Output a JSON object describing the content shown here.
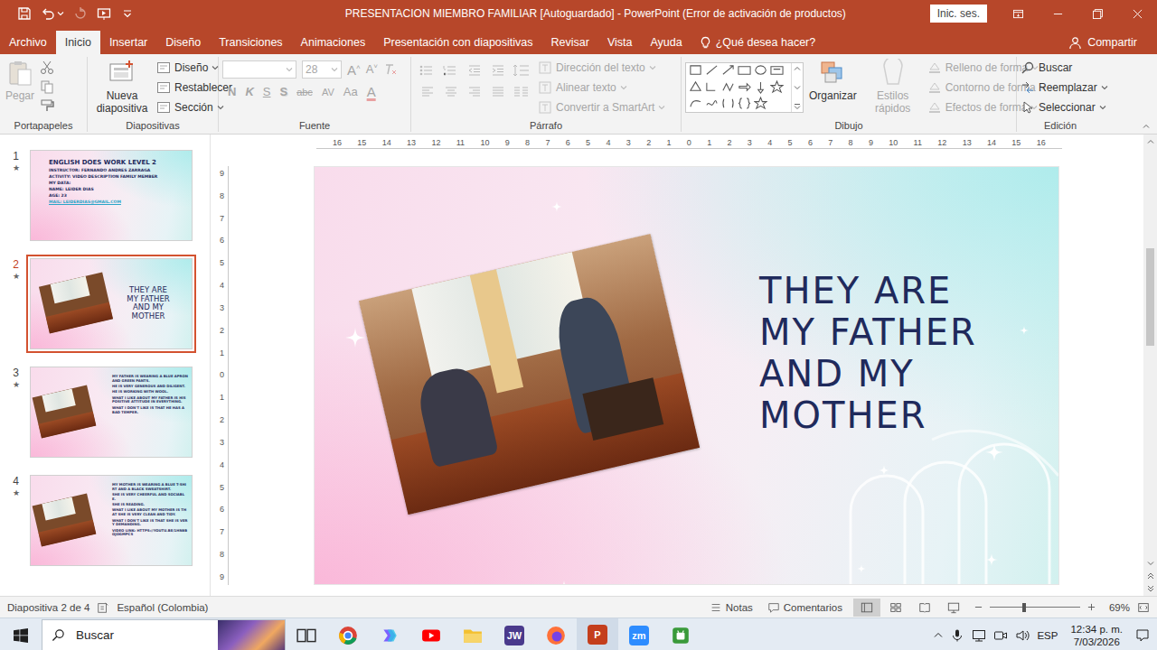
{
  "window": {
    "title": "PRESENTACION MIEMBRO FAMILIAR [Autoguardado] - PowerPoint (Error de activación de productos)",
    "signin": "Inic. ses."
  },
  "tabs": [
    {
      "label": "Archivo",
      "selected": false
    },
    {
      "label": "Inicio",
      "selected": true
    },
    {
      "label": "Insertar",
      "selected": false
    },
    {
      "label": "Diseño",
      "selected": false
    },
    {
      "label": "Transiciones",
      "selected": false
    },
    {
      "label": "Animaciones",
      "selected": false
    },
    {
      "label": "Presentación con diapositivas",
      "selected": false
    },
    {
      "label": "Revisar",
      "selected": false
    },
    {
      "label": "Vista",
      "selected": false
    },
    {
      "label": "Ayuda",
      "selected": false
    }
  ],
  "tell_me": "¿Qué desea hacer?",
  "share": "Compartir",
  "ribbon": {
    "clipboard": {
      "title": "Portapapeles",
      "paste": {
        "label": "Pegar",
        "disabled": true
      }
    },
    "slides": {
      "title": "Diapositivas",
      "new_slide": "Nueva diapositiva",
      "commands": [
        {
          "label": "Diseño",
          "dropdown": true
        },
        {
          "label": "Restablecer",
          "dropdown": false
        },
        {
          "label": "Sección",
          "dropdown": true
        }
      ]
    },
    "font": {
      "title": "Fuente",
      "name": "",
      "size": "28",
      "grow": "A",
      "shrink": "A",
      "styles": [
        "N",
        "K",
        "S",
        "S",
        "abc",
        "AV",
        "Aa",
        "A"
      ],
      "disabled": true
    },
    "paragraph": {
      "title": "Párrafo",
      "commands": [
        {
          "label": "Dirección del texto",
          "disabled": true
        },
        {
          "label": "Alinear texto",
          "disabled": true
        },
        {
          "label": "Convertir a SmartArt",
          "disabled": true
        }
      ]
    },
    "drawing": {
      "title": "Dibujo",
      "arrange": "Organizar",
      "quick_styles": {
        "label": "Estilos rápidos",
        "disabled": true
      },
      "commands": [
        {
          "label": "Relleno de forma",
          "disabled": true
        },
        {
          "label": "Contorno de forma",
          "disabled": true
        },
        {
          "label": "Efectos de forma",
          "disabled": true
        }
      ]
    },
    "editing": {
      "title": "Edición",
      "commands": [
        {
          "label": "Buscar",
          "dropdown": false
        },
        {
          "label": "Reemplazar",
          "dropdown": true
        },
        {
          "label": "Seleccionar",
          "dropdown": true
        }
      ]
    }
  },
  "rulers": {
    "horizontal": [
      "16",
      "15",
      "14",
      "13",
      "12",
      "11",
      "10",
      "9",
      "8",
      "7",
      "6",
      "5",
      "4",
      "3",
      "2",
      "1",
      "0",
      "1",
      "2",
      "3",
      "4",
      "5",
      "6",
      "7",
      "8",
      "9",
      "10",
      "11",
      "12",
      "13",
      "14",
      "15",
      "16"
    ],
    "vertical": [
      "9",
      "8",
      "7",
      "6",
      "5",
      "4",
      "3",
      "2",
      "1",
      "0",
      "1",
      "2",
      "3",
      "4",
      "5",
      "6",
      "7",
      "8",
      "9"
    ]
  },
  "thumbnails": [
    {
      "number": "1",
      "mark": "★",
      "selected": false,
      "kind": "title",
      "lines": [
        "ENGLISH DOES WORK LEVEL 2",
        "INSTRUCTOR: FERNANDO ANDRES ZARRAGA",
        "ACTIVITY: VIDEO DESCRIPTION FAMILY MEMBER",
        "MY DATA:",
        "NAME: LEIDER DIAS",
        "AGE: 23",
        "MAIL: LEIDERDIAS@GMAIL.COM"
      ]
    },
    {
      "number": "2",
      "mark": "★",
      "selected": true,
      "kind": "photo-title",
      "lines": [
        "THEY ARE MY FATHER AND MY MOTHER"
      ]
    },
    {
      "number": "3",
      "mark": "★",
      "selected": false,
      "kind": "photo-list",
      "lines": [
        "MY FATHER IS WEARING A BLUE APRON AND GREEN PANTS.",
        "HE IS VERY GENEROUS AND DILIGENT.",
        "HE IS WORKING WITH WOOL.",
        "WHAT I LIKE ABOUT MY FATHER IS HIS POSITIVE ATTITUDE IN EVERYTHING.",
        "WHAT I DON'T LIKE IS THAT HE HAS A BAD TEMPER."
      ]
    },
    {
      "number": "4",
      "mark": "★",
      "selected": false,
      "kind": "photo-list",
      "lines": [
        "MY MOTHER IS WEARING A BLUE T-SHIRT AND A BLACK SWEATSHIRT.",
        "SHE IS VERY CHEERFUL AND SOCIABLE.",
        "SHE IS READING.",
        "WHAT I LIKE ABOUT MY MOTHER IS THAT SHE IS VERY CLEAN AND TIDY.",
        "WHAT I DON'T LIKE IS THAT SHE IS VERY DEMANDING.",
        "VIDEO LINK: HTTPS://YOUTU.BE/1HN8BOJOGMPCS"
      ]
    }
  ],
  "slide": {
    "heading": "THEY ARE MY FATHER AND MY MOTHER"
  },
  "status_bar": {
    "slide_info": "Diapositiva 2 de 4",
    "language": "Español (Colombia)",
    "notes": "Notas",
    "comments": "Comentarios",
    "zoom": "69%",
    "zoom_level": 0.38,
    "views": [
      {
        "kind": "normal",
        "selected": true
      },
      {
        "kind": "sorter",
        "selected": false
      },
      {
        "kind": "reading",
        "selected": false
      },
      {
        "kind": "slideshow",
        "selected": false
      }
    ]
  },
  "taskbar": {
    "search_placeholder": "Buscar",
    "apps": [
      {
        "name": "task-view",
        "active": false,
        "color": "#2b2b2b"
      },
      {
        "name": "chrome",
        "active": false,
        "color": "#db4437"
      },
      {
        "name": "copilot",
        "active": false,
        "color": "#7b61ff"
      },
      {
        "name": "youtube",
        "active": false,
        "color": "#ff0000"
      },
      {
        "name": "explorer",
        "active": false,
        "color": "#f3c030"
      },
      {
        "name": "jw-player",
        "glyph": "JW",
        "active": false,
        "color": "#4a3a8c"
      },
      {
        "name": "firefox",
        "active": false,
        "color": "#ff7139"
      },
      {
        "name": "powerpoint",
        "glyph": "P",
        "active": true,
        "color": "#c43e1c"
      },
      {
        "name": "zoom",
        "glyph": "zm",
        "active": false,
        "color": "#2d8cff"
      },
      {
        "name": "android-app",
        "active": false,
        "color": "#3a9a3a"
      }
    ],
    "language": "ESP",
    "time": "12:34 p. m.",
    "date": "7/03/2026"
  }
}
